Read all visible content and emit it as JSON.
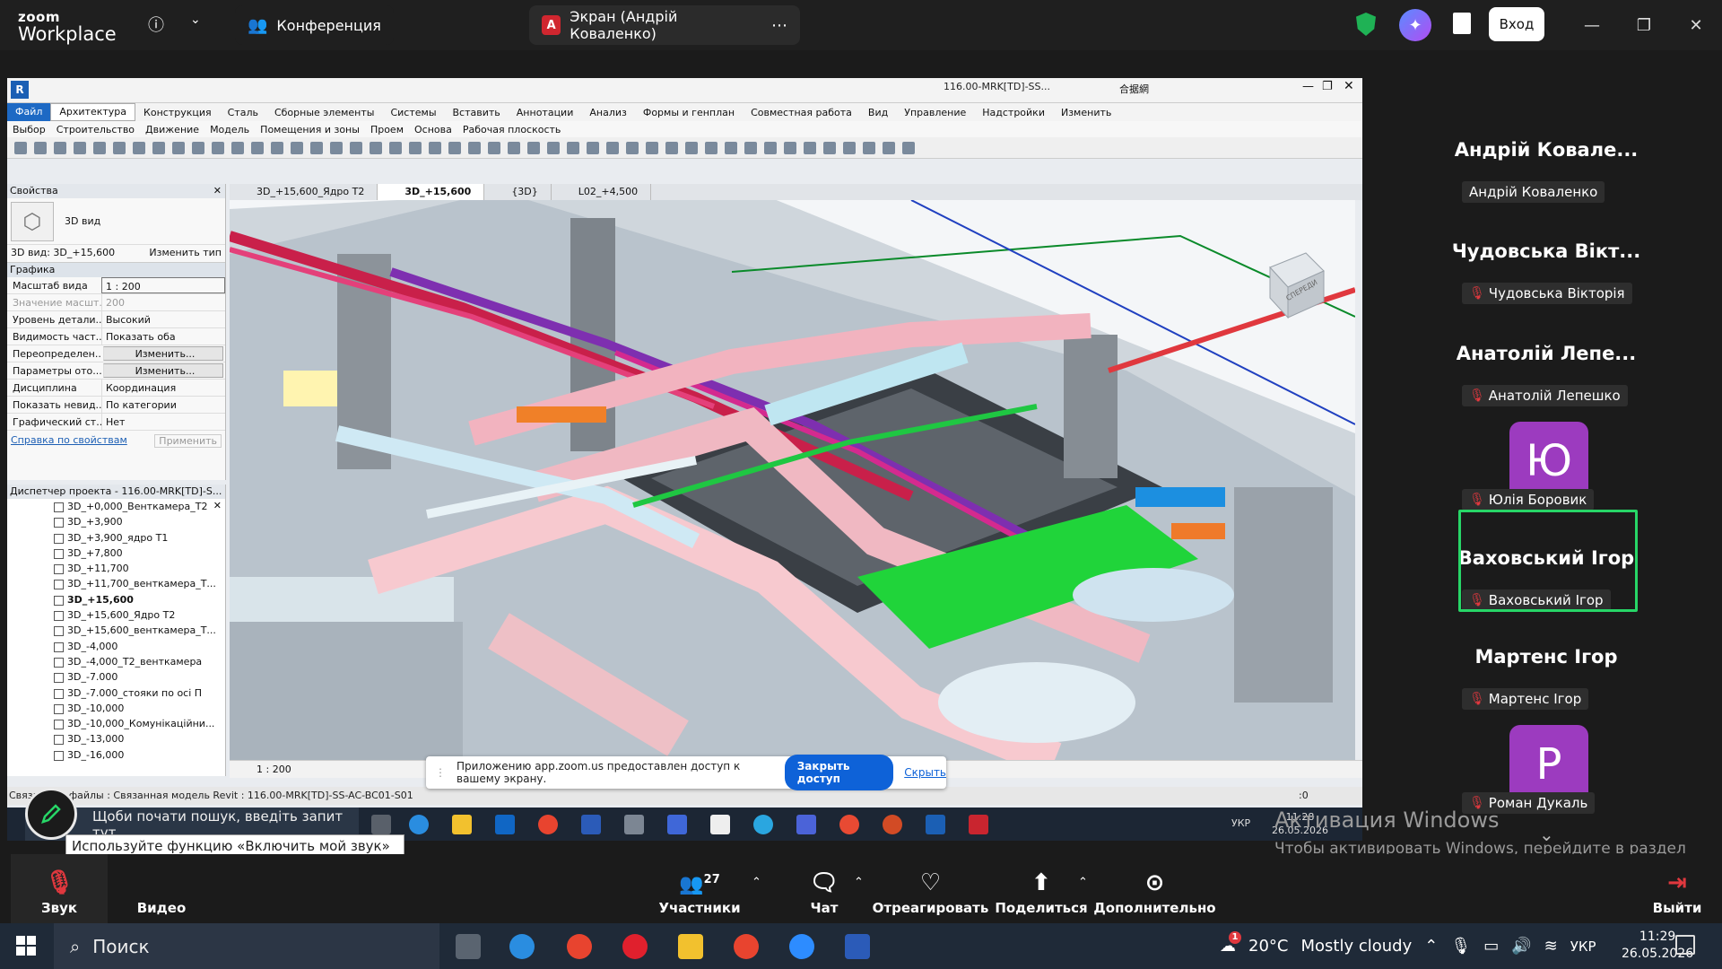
{
  "zoom": {
    "logo_line1": "zoom",
    "logo_line2": "Workplace",
    "tab_conference": "Конференция",
    "tab_screen": "Экран (Андрій Коваленко)",
    "tab_screen_badge": "A",
    "login": "Вход"
  },
  "revit": {
    "title": "116.00-MRK[TD]-SS...",
    "user": "合据網",
    "menu": [
      "Файл",
      "Архитектура",
      "Конструкция",
      "Сталь",
      "Сборные элементы",
      "Системы",
      "Вставить",
      "Аннотации",
      "Анализ",
      "Формы и генплан",
      "Совместная работа",
      "Вид",
      "Управление",
      "Надстройки",
      "Изменить"
    ],
    "submenu": [
      "Выбор",
      "Строительство",
      "Движение",
      "Модель",
      "Помещения и зоны",
      "Проем",
      "Основа",
      "Рабочая плоскость"
    ],
    "properties": {
      "header": "Свойства",
      "type": "3D вид",
      "view_select": "3D вид: 3D_+15,600",
      "edit_type": "Изменить тип",
      "section": "Графика",
      "rows": [
        {
          "k": "Масштаб вида",
          "v": "1 : 200"
        },
        {
          "k": "Значение масшт...",
          "v": "200"
        },
        {
          "k": "Уровень детали...",
          "v": "Высокий"
        },
        {
          "k": "Видимость част...",
          "v": "Показать оба"
        },
        {
          "k": "Переопределен...",
          "v": "Изменить..."
        },
        {
          "k": "Параметры ото...",
          "v": "Изменить..."
        },
        {
          "k": "Дисциплина",
          "v": "Координация"
        },
        {
          "k": "Показать невид...",
          "v": "По категории"
        },
        {
          "k": "Графический ст...",
          "v": "Нет"
        }
      ],
      "help_link": "Справка по свойствам",
      "apply": "Применить"
    },
    "browser": {
      "header": "Диспетчер проекта - 116.00-MRK[TD]-S...",
      "items": [
        "3D_+0,000_Венткамера_Т2",
        "3D_+3,900",
        "3D_+3,900_ядро Т1",
        "3D_+7,800",
        "3D_+11,700",
        "3D_+11,700_венткамера_Т...",
        "3D_+15,600",
        "3D_+15,600_Ядро Т2",
        "3D_+15,600_венткамера_Т...",
        "3D_-4,000",
        "3D_-4,000_Т2_венткамера",
        "3D_-7.000",
        "3D_-7.000_стояки по осі П",
        "3D_-10,000",
        "3D_-10,000_Комунікаційни...",
        "3D_-13,000",
        "3D_-16,000"
      ],
      "selected_index": 6
    },
    "view_tabs": [
      "3D_+15,600_Ядро Т2",
      "3D_+15,600",
      "{3D}",
      "L02_+4,500"
    ],
    "view_tab_selected": 1,
    "viewcube": "СПЕРЕДИ",
    "scale": "1 : 200",
    "statusbar": "Связанные файлы : Связанная модель Revit : 116.00-MRK[TD]-SS-AC-BC01-S01",
    "statusbar_right": ":0"
  },
  "share_banner": {
    "text": "Приложению app.zoom.us предоставлен доступ к вашему экрану.",
    "stop": "Закрыть доступ",
    "hide": "Скрыть"
  },
  "inner_taskbar": {
    "search": "Щоби почати пошук, введіть запит тут",
    "lang": "УКР",
    "time": "11:28",
    "date": "26.05.2026"
  },
  "tooltip": "Используйте функцию «Включить мой звук» (Alt+A). Или нажмите и удерживайте клавишу Space, чтобы временно включить звук.",
  "participants": [
    {
      "title": "Андрій Ковале...",
      "tag": "Андрій Коваленко",
      "muted": false
    },
    {
      "title": "Чудовська Вікт...",
      "tag": "Чудовська Вікторія",
      "muted": true
    },
    {
      "title": "Анатолій Лепе...",
      "tag": "Анатолій Лепешко",
      "muted": true
    },
    {
      "avatar": "Ю",
      "tag": "Юлія Боровик",
      "muted": true
    },
    {
      "title": "Ваховський Ігор",
      "tag": "Ваховський Ігор",
      "muted": true,
      "active": true
    },
    {
      "title": "Мартенс Ігор",
      "tag": "Мартенс Ігор",
      "muted": true
    },
    {
      "avatar": "Р",
      "tag": "Роман Дукаль",
      "muted": true
    }
  ],
  "activation": {
    "line1": "Активация Windows",
    "line2": "Чтобы активировать Windows, перейдите в раздел \"Параметры\"."
  },
  "controls": {
    "audio": "Звук",
    "video": "Видео",
    "participants": "Участники",
    "participants_count": "27",
    "chat": "Чат",
    "react": "Отреагировать",
    "share": "Поделиться",
    "more": "Дополнительно",
    "leave": "Выйти"
  },
  "taskbar": {
    "search": "Поиск",
    "weather_temp": "20°C",
    "weather_text": "Mostly cloudy",
    "weather_badge": "1",
    "lang": "УКР",
    "time": "11:29",
    "date": "26.05.2026"
  },
  "colors": {
    "accent": "#0e62d8",
    "active_border": "#27d667",
    "avatar": "#9c3bbf",
    "mic_muted": "#e0383e"
  }
}
